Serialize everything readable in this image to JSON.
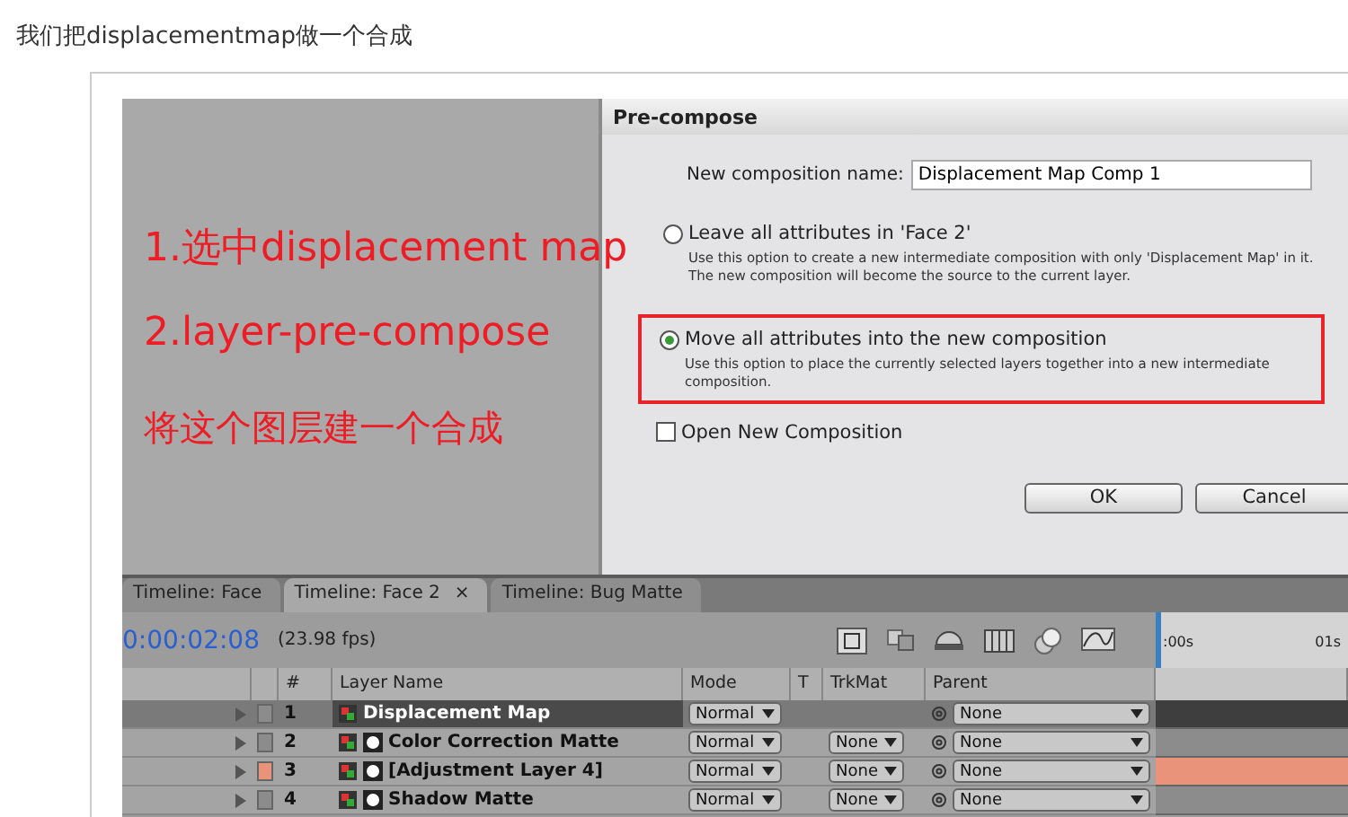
{
  "caption": "我们把displacementmap做一个合成",
  "annotations": [
    "1.选中displacement map",
    "2.layer-pre-compose",
    "将这个图层建一个合成"
  ],
  "dialog": {
    "title": "Pre-compose",
    "name_label": "New composition name:",
    "name_value": "Displacement Map Comp 1",
    "options": [
      {
        "label": "Leave all attributes in 'Face 2'",
        "description": "Use this option to create a new intermediate composition with only 'Displacement Map' in it.  The new composition will become the source to the current layer.",
        "selected": false,
        "highlighted": false
      },
      {
        "label": "Move all attributes into the new composition",
        "description": "Use this option to place the currently selected layers together into a new intermediate composition.",
        "selected": true,
        "highlighted": true
      }
    ],
    "open_new": {
      "label": "Open New Composition",
      "checked": false
    },
    "buttons": [
      "OK",
      "Cancel"
    ]
  },
  "timeline": {
    "tabs": [
      {
        "label": "Timeline: Face",
        "selected": false
      },
      {
        "label": "Timeline: Face 2",
        "selected": true,
        "close": "×"
      },
      {
        "label": "Timeline: Bug Matte",
        "selected": false
      }
    ],
    "timecode": "0:00:02:08",
    "fps": "(23.98 fps)",
    "columns": [
      "#",
      "Layer Name",
      "Mode",
      "T",
      "TrkMat",
      "Parent"
    ],
    "ruler": [
      ":00s",
      "01s"
    ],
    "layers": [
      {
        "number": "1",
        "name": "Displacement Map",
        "mode": "Normal",
        "parent": "None",
        "selected": true,
        "color": "#8c8c8c"
      },
      {
        "number": "2",
        "name": "Color Correction Matte",
        "mode": "Normal",
        "trkmat": "None",
        "parent": "None",
        "selected": false,
        "color": "#8c8c8c"
      },
      {
        "number": "3",
        "name": "[Adjustment Layer 4]",
        "mode": "Normal",
        "trkmat": "None",
        "parent": "None",
        "selected": false,
        "color": "#e8937a"
      },
      {
        "number": "4",
        "name": "Shadow Matte",
        "mode": "Normal",
        "trkmat": "None",
        "parent": "None",
        "selected": false,
        "color": "#8c8c8c"
      }
    ]
  }
}
